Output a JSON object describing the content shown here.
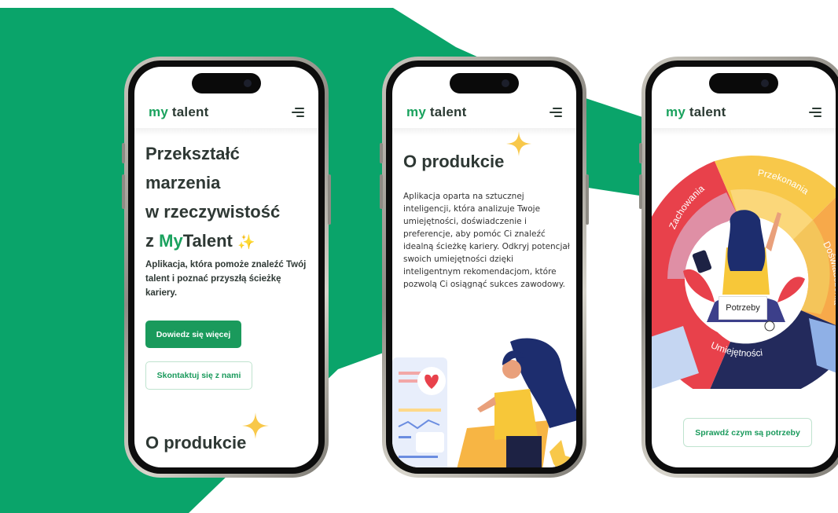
{
  "colors": {
    "brand_green": "#1aa25e",
    "background_green": "#0aa46a",
    "text_dark": "#2e3834",
    "sparkle_yellow": "#f8c84a"
  },
  "logo": {
    "prefix": "my",
    "suffix": " talent"
  },
  "phone1": {
    "title_line1": "Przekształć",
    "title_line2": "marzenia",
    "title_line3": "w rzeczywistość",
    "title_line4_prefix": "z ",
    "title_line4_accent": "My",
    "title_line4_rest": "Talent",
    "description": "Aplikacja, która pomoże znaleźć Twój talent i poznać przyszłą ścieżkę kariery.",
    "primary_button": "Dowiedz się więcej",
    "secondary_button": "Skontaktuj się z nami",
    "section_title": "O produkcie"
  },
  "phone2": {
    "section_title": "O produkcie",
    "body": "Aplikacja oparta na sztucznej inteligencji, która analizuje Twoje umiejętności, doświadczenie i preferencje, aby pomóc Ci znaleźć idealną ścieżkę kariery. Odkryj potencjał swoich umiejętności dzięki inteligentnym rekomendacjom, które pozwolą Ci osiągnąć sukces zawodowy."
  },
  "phone3": {
    "wheel_labels": {
      "top": "Przekonania",
      "left": "Zachowania",
      "right": "Doświadczenia",
      "bottom": "Umiejętności",
      "center": "Potrzeby"
    },
    "button": "Sprawdź czym są potrzeby"
  },
  "icons": {
    "menu": "menu-icon",
    "sparkle": "sparkle-icon",
    "heart": "heart-icon"
  }
}
